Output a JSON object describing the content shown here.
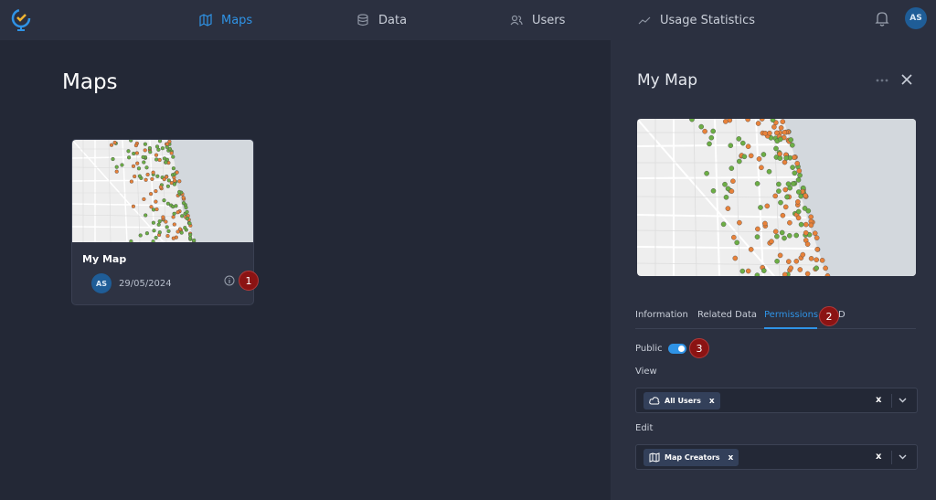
{
  "nav": {
    "items": [
      {
        "label": "Maps",
        "icon": "map-icon",
        "active": true
      },
      {
        "label": "Data",
        "icon": "database-icon",
        "active": false
      },
      {
        "label": "Users",
        "icon": "users-icon",
        "active": false
      },
      {
        "label": "Usage Statistics",
        "icon": "line-chart-icon",
        "active": false
      }
    ],
    "avatar": "AS"
  },
  "main": {
    "title": "Maps",
    "card": {
      "title": "My Map",
      "avatar": "AS",
      "date": "29/05/2024"
    }
  },
  "annotations": [
    "1",
    "2",
    "3"
  ],
  "panel": {
    "title": "My Map",
    "tabs": [
      "Information",
      "Related Data",
      "Permissions",
      "D"
    ],
    "active_tab": "Permissions",
    "public_label": "Public",
    "public_on": true,
    "view_label": "View",
    "view_chip": "All Users",
    "edit_label": "Edit",
    "edit_chip": "Map Creators",
    "chip_remove": "x",
    "clear": "x"
  },
  "colors": {
    "accent": "#2f93e6",
    "background": "#232836",
    "panel": "#2b3040",
    "badge": "#8b1313",
    "point_orange": "#e8823a",
    "point_green": "#6cae45"
  }
}
